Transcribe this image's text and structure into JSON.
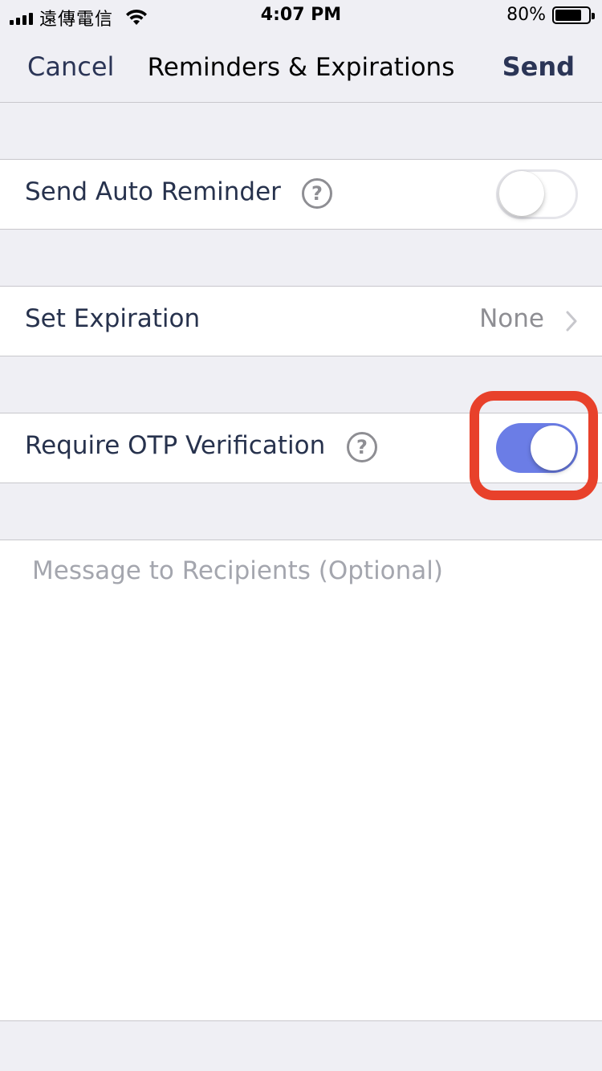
{
  "status_bar": {
    "carrier": "遠傳電信",
    "time": "4:07 PM",
    "battery": "80%",
    "battery_level": 0.8
  },
  "nav": {
    "cancel": "Cancel",
    "title": "Reminders & Expirations",
    "send": "Send"
  },
  "settings": {
    "auto_reminder": {
      "label": "Send Auto Reminder",
      "help": "?",
      "enabled": false
    },
    "expiration": {
      "label": "Set Expiration",
      "value": "None"
    },
    "otp": {
      "label": "Require OTP Verification",
      "help": "?",
      "enabled": true
    }
  },
  "message": {
    "placeholder": "Message to Recipients (Optional)",
    "value": ""
  },
  "colors": {
    "accent": "#6b7de6",
    "nav_text": "#2b3556",
    "highlight": "#e8412b",
    "background": "#efeff4"
  }
}
